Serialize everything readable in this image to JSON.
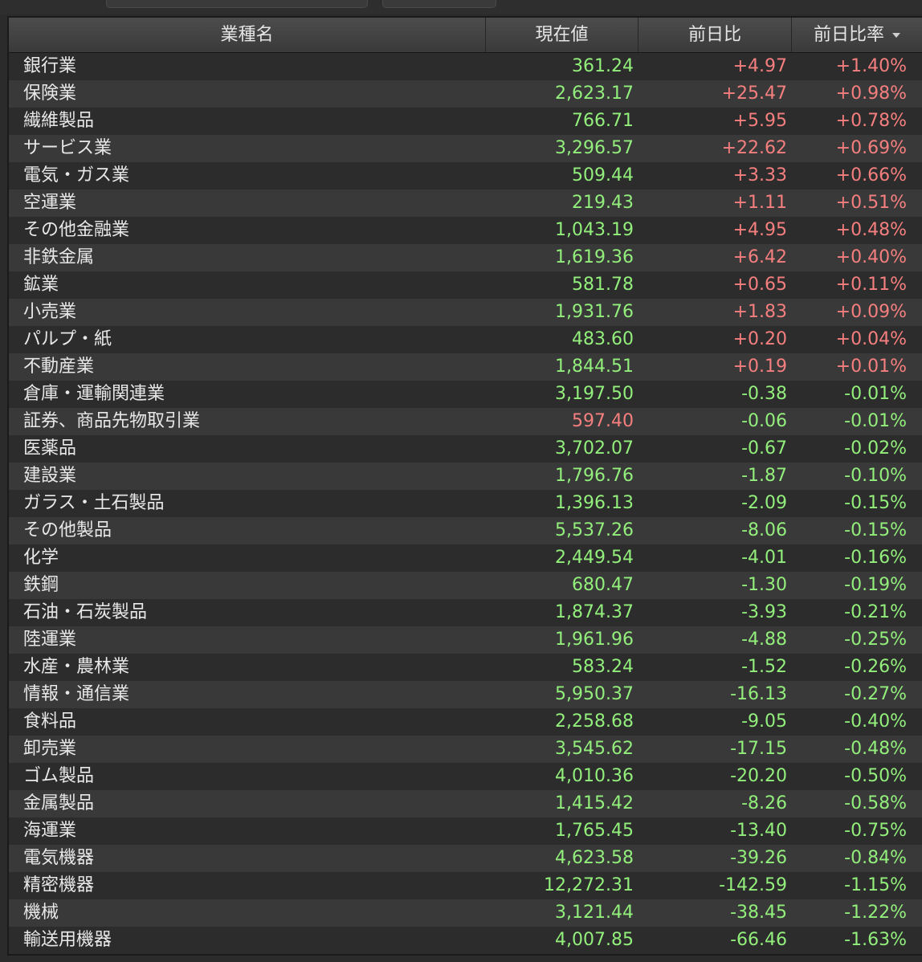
{
  "header": {
    "col_name": "業種名",
    "col_value": "現在値",
    "col_change": "前日比",
    "col_change_rate": "前日比率"
  },
  "colors": {
    "positive": "#f57f7f",
    "negative": "#93ef7c",
    "value_default": "#93ef7c"
  },
  "rows": [
    {
      "name": "銀行業",
      "value": "361.24",
      "change": "+4.97",
      "rate": "+1.40%",
      "value_color": "green"
    },
    {
      "name": "保険業",
      "value": "2,623.17",
      "change": "+25.47",
      "rate": "+0.98%",
      "value_color": "green"
    },
    {
      "name": "繊維製品",
      "value": "766.71",
      "change": "+5.95",
      "rate": "+0.78%",
      "value_color": "green"
    },
    {
      "name": "サービス業",
      "value": "3,296.57",
      "change": "+22.62",
      "rate": "+0.69%",
      "value_color": "green"
    },
    {
      "name": "電気・ガス業",
      "value": "509.44",
      "change": "+3.33",
      "rate": "+0.66%",
      "value_color": "green"
    },
    {
      "name": "空運業",
      "value": "219.43",
      "change": "+1.11",
      "rate": "+0.51%",
      "value_color": "green"
    },
    {
      "name": "その他金融業",
      "value": "1,043.19",
      "change": "+4.95",
      "rate": "+0.48%",
      "value_color": "green"
    },
    {
      "name": "非鉄金属",
      "value": "1,619.36",
      "change": "+6.42",
      "rate": "+0.40%",
      "value_color": "green"
    },
    {
      "name": "鉱業",
      "value": "581.78",
      "change": "+0.65",
      "rate": "+0.11%",
      "value_color": "green"
    },
    {
      "name": "小売業",
      "value": "1,931.76",
      "change": "+1.83",
      "rate": "+0.09%",
      "value_color": "green"
    },
    {
      "name": "パルプ・紙",
      "value": "483.60",
      "change": "+0.20",
      "rate": "+0.04%",
      "value_color": "green"
    },
    {
      "name": "不動産業",
      "value": "1,844.51",
      "change": "+0.19",
      "rate": "+0.01%",
      "value_color": "green"
    },
    {
      "name": "倉庫・運輸関連業",
      "value": "3,197.50",
      "change": "-0.38",
      "rate": "-0.01%",
      "value_color": "green"
    },
    {
      "name": "証券、商品先物取引業",
      "value": "597.40",
      "change": "-0.06",
      "rate": "-0.01%",
      "value_color": "red"
    },
    {
      "name": "医薬品",
      "value": "3,702.07",
      "change": "-0.67",
      "rate": "-0.02%",
      "value_color": "green"
    },
    {
      "name": "建設業",
      "value": "1,796.76",
      "change": "-1.87",
      "rate": "-0.10%",
      "value_color": "green"
    },
    {
      "name": "ガラス・土石製品",
      "value": "1,396.13",
      "change": "-2.09",
      "rate": "-0.15%",
      "value_color": "green"
    },
    {
      "name": "その他製品",
      "value": "5,537.26",
      "change": "-8.06",
      "rate": "-0.15%",
      "value_color": "green"
    },
    {
      "name": "化学",
      "value": "2,449.54",
      "change": "-4.01",
      "rate": "-0.16%",
      "value_color": "green"
    },
    {
      "name": "鉄鋼",
      "value": "680.47",
      "change": "-1.30",
      "rate": "-0.19%",
      "value_color": "green"
    },
    {
      "name": "石油・石炭製品",
      "value": "1,874.37",
      "change": "-3.93",
      "rate": "-0.21%",
      "value_color": "green"
    },
    {
      "name": "陸運業",
      "value": "1,961.96",
      "change": "-4.88",
      "rate": "-0.25%",
      "value_color": "green"
    },
    {
      "name": "水産・農林業",
      "value": "583.24",
      "change": "-1.52",
      "rate": "-0.26%",
      "value_color": "green"
    },
    {
      "name": "情報・通信業",
      "value": "5,950.37",
      "change": "-16.13",
      "rate": "-0.27%",
      "value_color": "green"
    },
    {
      "name": "食料品",
      "value": "2,258.68",
      "change": "-9.05",
      "rate": "-0.40%",
      "value_color": "green"
    },
    {
      "name": "卸売業",
      "value": "3,545.62",
      "change": "-17.15",
      "rate": "-0.48%",
      "value_color": "green"
    },
    {
      "name": "ゴム製品",
      "value": "4,010.36",
      "change": "-20.20",
      "rate": "-0.50%",
      "value_color": "green"
    },
    {
      "name": "金属製品",
      "value": "1,415.42",
      "change": "-8.26",
      "rate": "-0.58%",
      "value_color": "green"
    },
    {
      "name": "海運業",
      "value": "1,765.45",
      "change": "-13.40",
      "rate": "-0.75%",
      "value_color": "green"
    },
    {
      "name": "電気機器",
      "value": "4,623.58",
      "change": "-39.26",
      "rate": "-0.84%",
      "value_color": "green"
    },
    {
      "name": "精密機器",
      "value": "12,272.31",
      "change": "-142.59",
      "rate": "-1.15%",
      "value_color": "green"
    },
    {
      "name": "機械",
      "value": "3,121.44",
      "change": "-38.45",
      "rate": "-1.22%",
      "value_color": "green"
    },
    {
      "name": "輸送用機器",
      "value": "4,007.85",
      "change": "-66.46",
      "rate": "-1.63%",
      "value_color": "green"
    }
  ]
}
